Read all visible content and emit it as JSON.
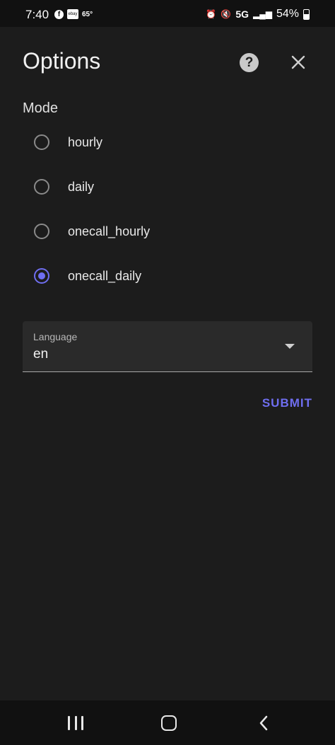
{
  "status_bar": {
    "time": "7:40",
    "fb_icon": "f",
    "ebay_icon": "ebay",
    "temperature": "65°",
    "network": "5G",
    "battery": "54%"
  },
  "dialog": {
    "title": "Options",
    "help_glyph": "?",
    "mode_label": "Mode",
    "modes": [
      {
        "label": "hourly",
        "selected": false
      },
      {
        "label": "daily",
        "selected": false
      },
      {
        "label": "onecall_hourly",
        "selected": false
      },
      {
        "label": "onecall_daily",
        "selected": true
      }
    ],
    "language": {
      "label": "Language",
      "value": "en"
    },
    "submit_label": "SUBMIT"
  },
  "colors": {
    "background": "#1c1c1c",
    "accent": "#6f6ef0",
    "field": "#2a2a2a"
  },
  "icons": [
    "help-icon",
    "close-icon",
    "dropdown-caret-icon",
    "nav-recents-icon",
    "nav-home-icon",
    "nav-back-icon"
  ]
}
